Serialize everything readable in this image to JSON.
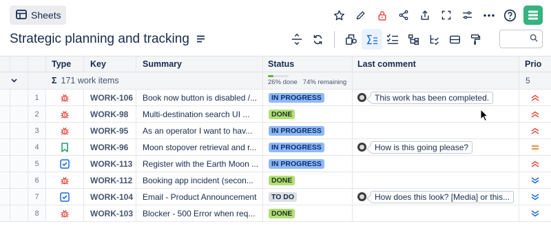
{
  "header": {
    "sheets_label": "Sheets",
    "title": "Strategic planning and tracking"
  },
  "columns": {
    "type": "Type",
    "key": "Key",
    "summary": "Summary",
    "status": "Status",
    "last_comment": "Last comment",
    "priority": "Prio"
  },
  "summary_row": {
    "sigma": "Σ",
    "work_items": "171 work items",
    "done_pct": "26% done",
    "remaining_pct": "74% remaining",
    "done_fraction": 0.26,
    "priority_count": "5"
  },
  "rows": [
    {
      "num": "1",
      "type": "bug",
      "key": "WORK-106",
      "summary": "Book now button is disabled /...",
      "status": "IN PROGRESS",
      "status_kind": "inprogress",
      "comment": "This work has been completed.",
      "priority": "high"
    },
    {
      "num": "2",
      "type": "bug",
      "key": "WORK-98",
      "summary": "Multi-destination search UI ...",
      "status": "DONE",
      "status_kind": "done",
      "comment": "",
      "priority": "high"
    },
    {
      "num": "3",
      "type": "bug",
      "key": "WORK-95",
      "summary": "As an operator I want to hav...",
      "status": "IN PROGRESS",
      "status_kind": "inprogress",
      "comment": "",
      "priority": "high"
    },
    {
      "num": "4",
      "type": "story",
      "key": "WORK-96",
      "summary": "Moon stopover retrieval and r...",
      "status": "IN PROGRESS",
      "status_kind": "inprogress",
      "comment": "How is this going please?",
      "priority": "medium"
    },
    {
      "num": "5",
      "type": "task",
      "key": "WORK-113",
      "summary": "Register with the Earth Moon ...",
      "status": "IN PROGRESS",
      "status_kind": "inprogress",
      "comment": "",
      "priority": "high"
    },
    {
      "num": "6",
      "type": "bug",
      "key": "WORK-112",
      "summary": "Booking app incident (secon...",
      "status": "DONE",
      "status_kind": "done",
      "comment": "",
      "priority": "low"
    },
    {
      "num": "7",
      "type": "task",
      "key": "WORK-104",
      "summary": "Email - Product Announcement",
      "status": "TO DO",
      "status_kind": "todo",
      "comment": "How does this look? [Media] or this...",
      "priority": "low"
    },
    {
      "num": "8",
      "type": "bug",
      "key": "WORK-103",
      "summary": "Blocker - 500 Error when req...",
      "status": "DONE",
      "status_kind": "done",
      "comment": "",
      "priority": "low"
    }
  ],
  "colors": {
    "bug": "#e2483d",
    "story": "#22a06b",
    "task": "#1868db",
    "priority_high": "#e2483d",
    "priority_medium": "#e56910",
    "priority_low": "#1868db",
    "brand": "#36b37e"
  }
}
